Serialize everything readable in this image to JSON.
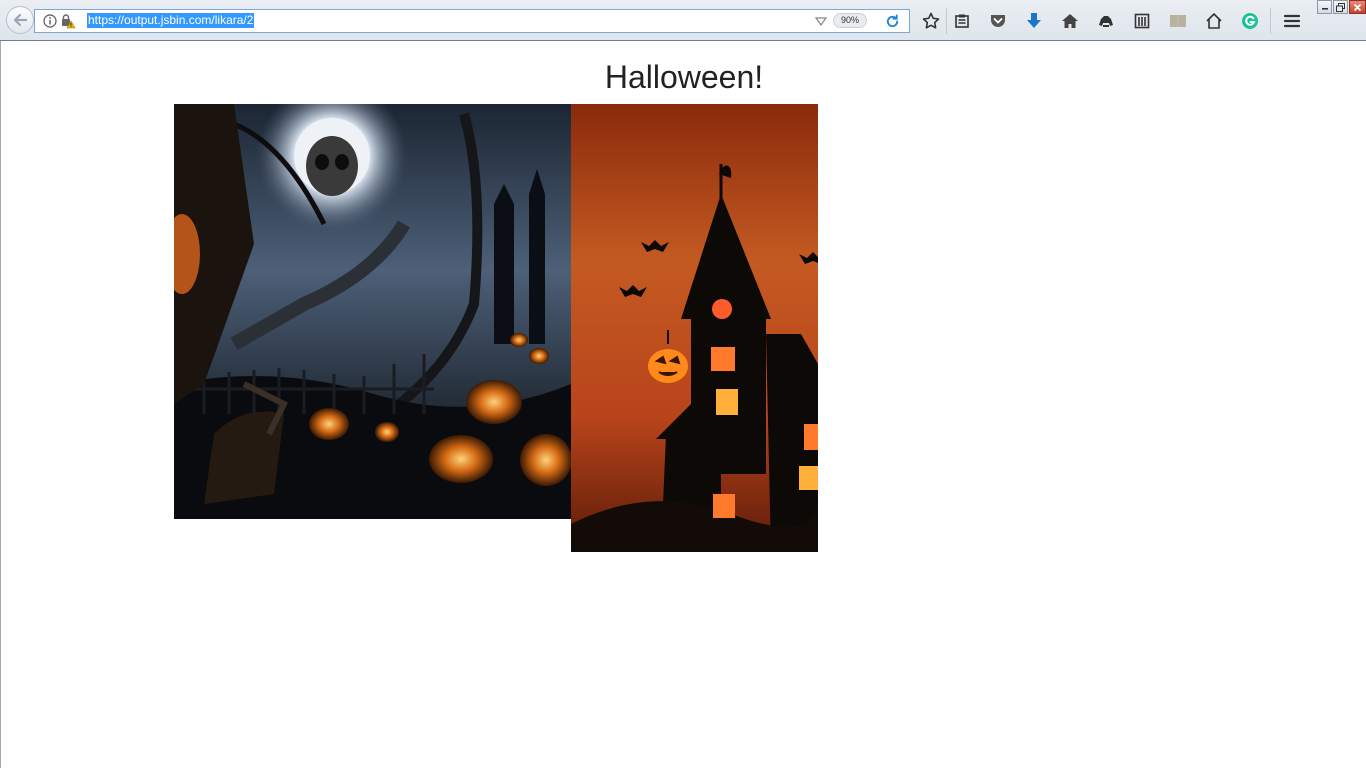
{
  "browser": {
    "url": "https://output.jsbin.com/likara/2",
    "zoom": "90%"
  },
  "page": {
    "title": "Halloween!",
    "images": [
      {
        "name": "scarecrow-moon-pumpkins-image",
        "description_colors": [
          "#3b4a5e",
          "#0d0d10",
          "#e07b1c"
        ]
      },
      {
        "name": "haunted-house-image",
        "description_colors": [
          "#c2461a",
          "#0a0807",
          "#ff9a2a"
        ]
      }
    ]
  },
  "icons": {
    "back": "back-arrow-icon",
    "info": "info-icon",
    "lock": "lock-warning-icon",
    "bookmark": "star-icon",
    "reading_list": "clipboard-icon",
    "pocket": "pocket-icon",
    "downloads": "download-arrow-icon",
    "home": "home-icon",
    "sync": "sync-icon",
    "library": "library-icon",
    "reader": "book-icon",
    "home2": "house-outline-icon",
    "grammarly": "grammarly-icon",
    "menu": "hamburger-menu-icon"
  }
}
